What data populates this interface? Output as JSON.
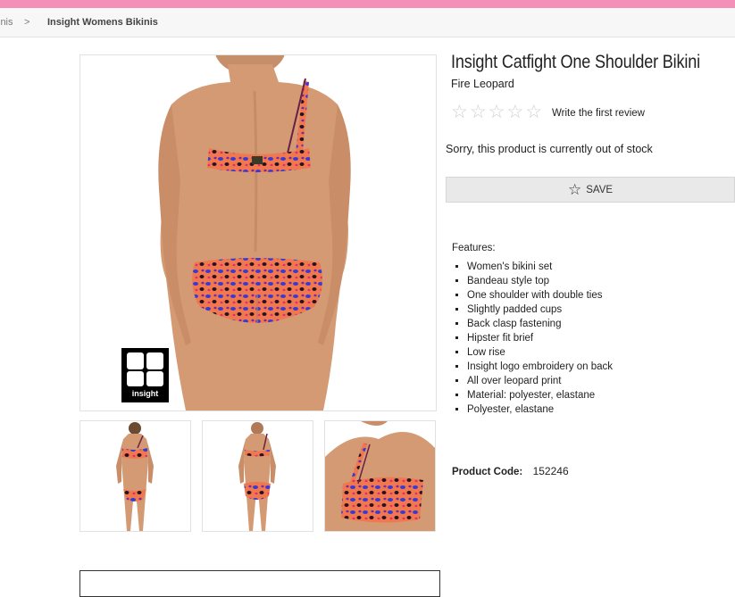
{
  "breadcrumb": {
    "prev": "inis",
    "separator": ">",
    "current": "Insight Womens Bikinis"
  },
  "product": {
    "title": "Insight Catfight One Shoulder Bikini",
    "color": "Fire Leopard",
    "rating_stars": 5,
    "review_link": "Write the first review",
    "stock_message": "Sorry, this product is currently out of stock",
    "save_label": "SAVE",
    "features_label": "Features:",
    "features": [
      "Women's bikini set",
      "Bandeau style top",
      "One shoulder with double ties",
      "Slightly padded cups",
      "Back clasp fastening",
      "Hipster fit brief",
      "Low rise",
      "Insight logo embroidery on back",
      "All over leopard print",
      "Material: polyester, elastane",
      "Polyester, elastane"
    ],
    "code_label": "Product Code:",
    "code_value": "152246"
  },
  "brand_logo_text": "insight",
  "colors": {
    "top_bar": "#f48fb8",
    "skin": "#d39a73",
    "print_base": "#f07850",
    "print_blue": "#3a3ad0",
    "print_dark": "#2a1020"
  }
}
